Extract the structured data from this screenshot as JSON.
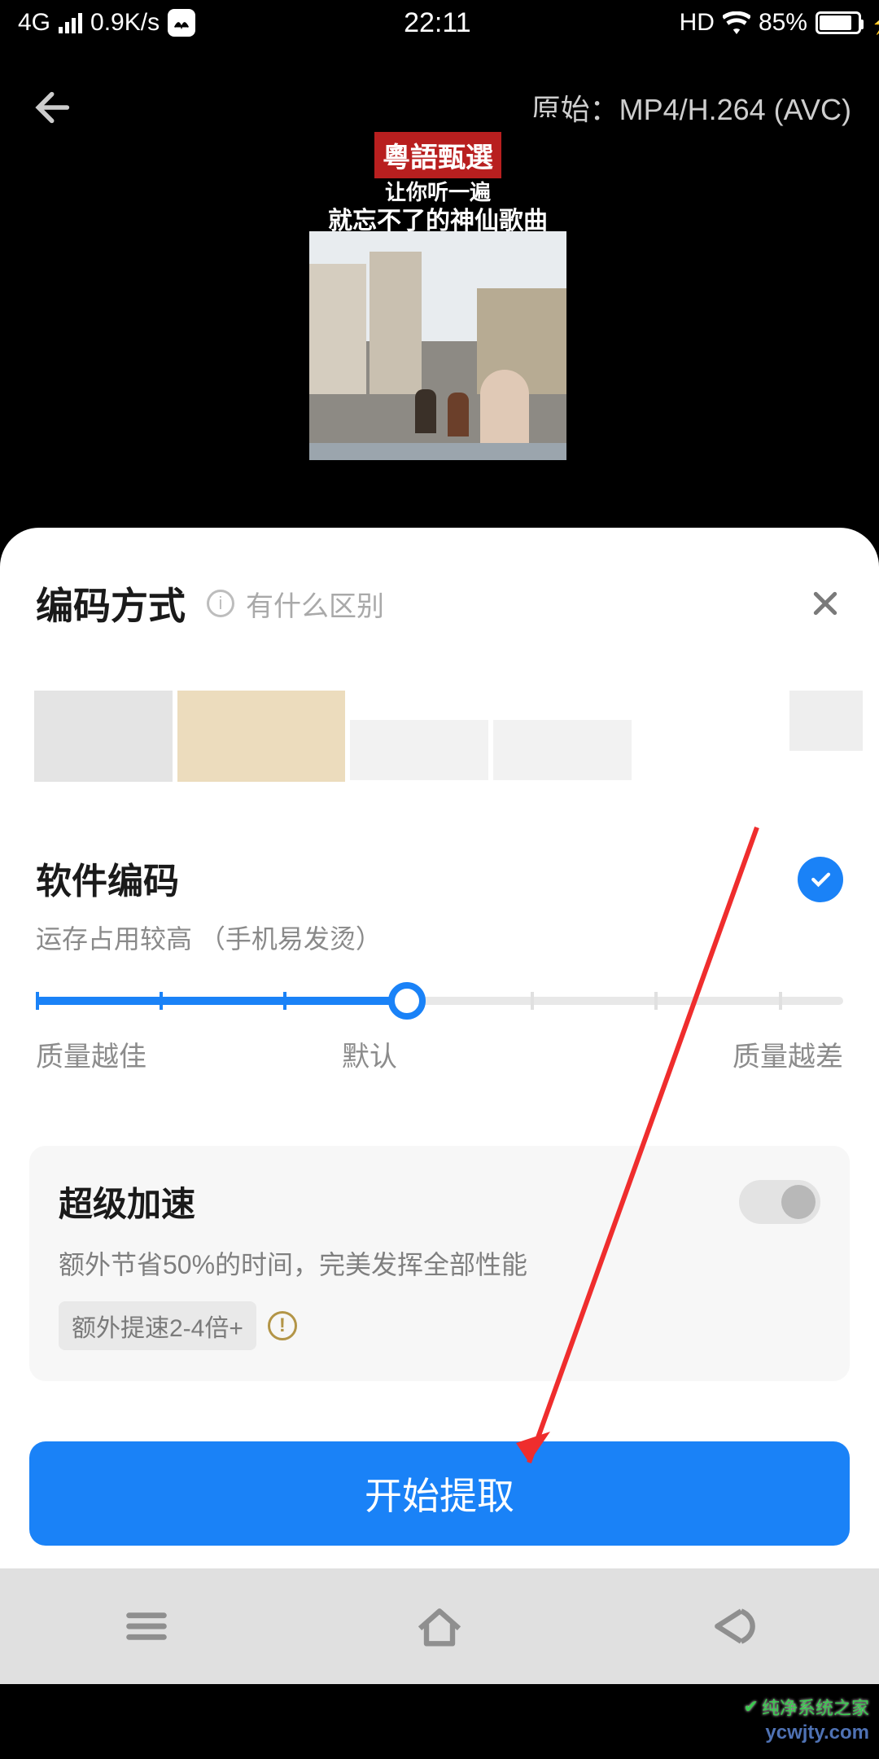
{
  "status": {
    "network": "4G",
    "speed": "0.9K/s",
    "time": "22:11",
    "hd": "HD",
    "battery_pct": "85%"
  },
  "header": {
    "original_label": "原始：",
    "format": "MP4/H.264 (AVC)"
  },
  "thumb": {
    "badge": "粵語甄選",
    "line1": "让你听一遍",
    "line2": "就忘不了的神仙歌曲"
  },
  "sheet": {
    "title": "编码方式",
    "subtitle": "有什么区别"
  },
  "software": {
    "title": "软件编码",
    "desc": "运存占用较高 （手机易发烫）"
  },
  "slider": {
    "left": "质量越佳",
    "mid": "默认",
    "right": "质量越差"
  },
  "accel": {
    "title": "超级加速",
    "desc": "额外节省50%的时间，完美发挥全部性能",
    "badge": "额外提速2-4倍+"
  },
  "action": {
    "start": "开始提取"
  },
  "watermark": {
    "w1": "纯净系统之家",
    "w2": "ycwjty.com"
  }
}
